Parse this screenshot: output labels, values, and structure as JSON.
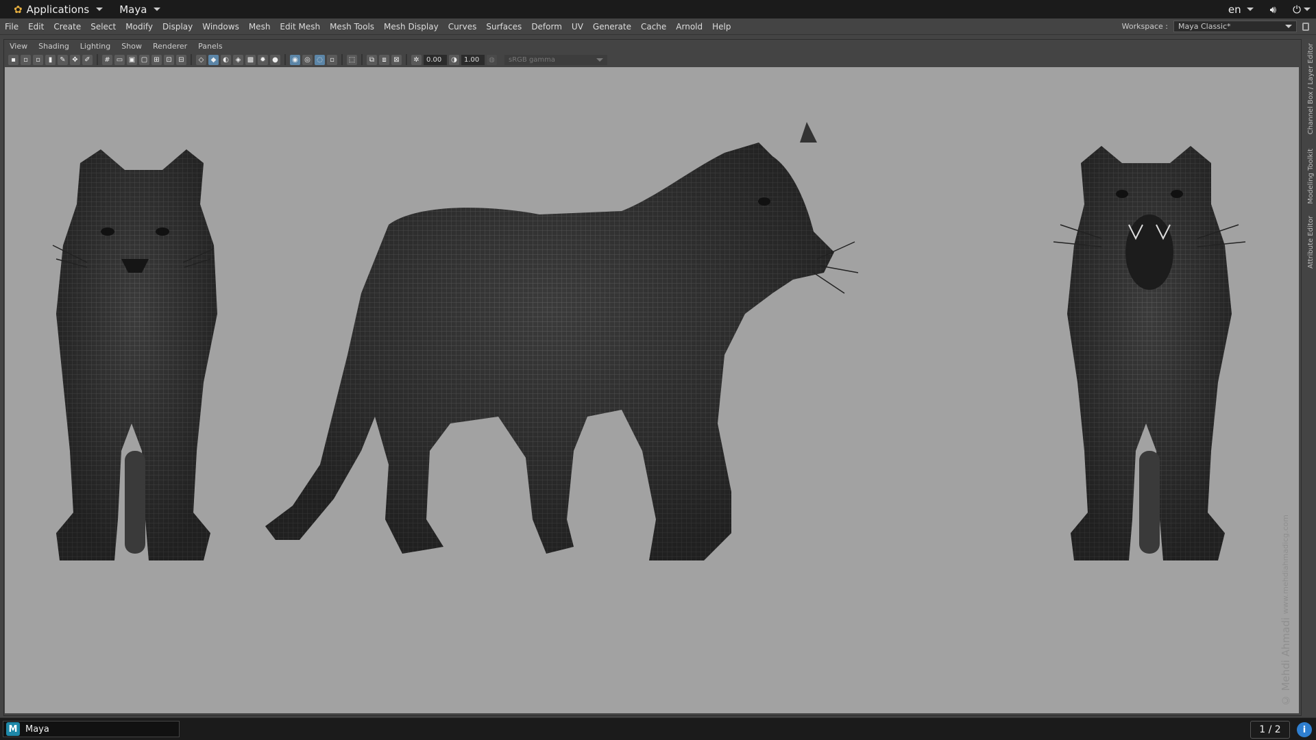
{
  "topbar": {
    "applications": "Applications",
    "maya": "Maya",
    "lang": "en"
  },
  "menubar": [
    "File",
    "Edit",
    "Create",
    "Select",
    "Modify",
    "Display",
    "Windows",
    "Mesh",
    "Edit Mesh",
    "Mesh Tools",
    "Mesh Display",
    "Curves",
    "Surfaces",
    "Deform",
    "UV",
    "Generate",
    "Cache",
    "Arnold",
    "Help"
  ],
  "workspace": {
    "label": "Workspace :",
    "value": "Maya Classic*"
  },
  "panel_menu": [
    "View",
    "Shading",
    "Lighting",
    "Show",
    "Renderer",
    "Panels"
  ],
  "toolbar": {
    "exposure": "0.00",
    "gamma": "1.00",
    "color_space": "sRGB gamma"
  },
  "side_tabs": [
    "Channel Box / Layer Editor",
    "Modeling Toolkit",
    "Attribute Editor"
  ],
  "watermark": {
    "name": "© Mehdi Ahmadi",
    "site": "www.mehdiahmadicg.com"
  },
  "taskbar": {
    "app": "Maya",
    "pager": "1 / 2"
  },
  "colors": {
    "viewport_bg": "#a2a2a2",
    "mesh": "#2f2f2f",
    "wire": "#555555",
    "accent": "#5c86a8"
  }
}
